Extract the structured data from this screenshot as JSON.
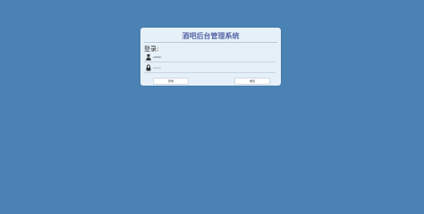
{
  "app": {
    "title": "酒吧后台管理系统"
  },
  "form": {
    "section_label": "登录:",
    "username": {
      "icon": "user-icon",
      "value": "admin"
    },
    "password": {
      "icon": "lock-icon",
      "value": "•••••"
    },
    "login_label": "登录",
    "reset_label": "重置"
  }
}
